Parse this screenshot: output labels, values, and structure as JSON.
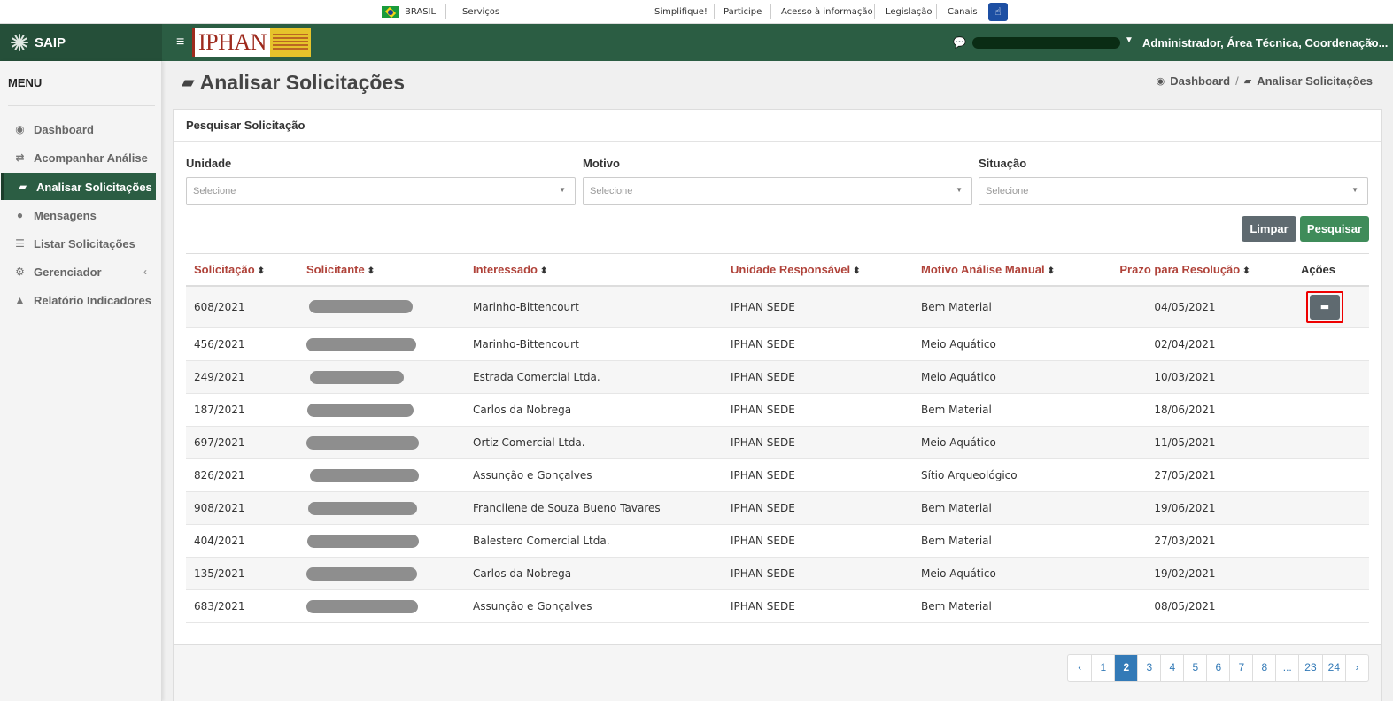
{
  "govbar": {
    "brasil": "BRASIL",
    "servicos": "Serviços",
    "links": [
      "Simplifique!",
      "Participe",
      "Acesso à informação",
      "Legislação",
      "Canais"
    ]
  },
  "header": {
    "app_name": "SAIP",
    "logo_text": "IPHAN",
    "user_roles": "Administrador, Área Técnica, Coordenação..."
  },
  "sidebar": {
    "title": "MENU",
    "items": [
      {
        "label": "Dashboard",
        "icon": "dashboard-icon"
      },
      {
        "label": "Acompanhar Análise",
        "icon": "exchange-icon"
      },
      {
        "label": "Analisar Solicitações",
        "icon": "book-icon",
        "active": true
      },
      {
        "label": "Mensagens",
        "icon": "comments-icon"
      },
      {
        "label": "Listar Solicitações",
        "icon": "list-icon"
      },
      {
        "label": "Gerenciador",
        "icon": "gears-icon"
      },
      {
        "label": "Relatório Indicadores",
        "icon": "area-chart-icon"
      }
    ]
  },
  "page": {
    "title": "Analisar Solicitações",
    "breadcrumb": [
      "Dashboard",
      "Analisar Solicitações"
    ]
  },
  "search": {
    "panel_title": "Pesquisar Solicitação",
    "filters": [
      {
        "label": "Unidade",
        "placeholder": "Selecione"
      },
      {
        "label": "Motivo",
        "placeholder": "Selecione"
      },
      {
        "label": "Situação",
        "placeholder": "Selecione"
      }
    ],
    "clear_label": "Limpar",
    "search_label": "Pesquisar"
  },
  "table": {
    "columns": [
      "Solicitação",
      "Solicitante",
      "Interessado",
      "Unidade Responsável",
      "Motivo Análise Manual",
      "Prazo para Resolução",
      "Ações"
    ],
    "rows": [
      {
        "solicitacao": "608/2021",
        "interessado": "Marinho-Bittencourt",
        "unidade": "IPHAN SEDE",
        "motivo": "Bem Material",
        "prazo": "04/05/2021"
      },
      {
        "solicitacao": "456/2021",
        "interessado": "Marinho-Bittencourt",
        "unidade": "IPHAN SEDE",
        "motivo": "Meio Aquático",
        "prazo": "02/04/2021"
      },
      {
        "solicitacao": "249/2021",
        "interessado": "Estrada Comercial Ltda.",
        "unidade": "IPHAN SEDE",
        "motivo": "Meio Aquático",
        "prazo": "10/03/2021"
      },
      {
        "solicitacao": "187/2021",
        "interessado": "Carlos da Nobrega",
        "unidade": "IPHAN SEDE",
        "motivo": "Bem Material",
        "prazo": "18/06/2021"
      },
      {
        "solicitacao": "697/2021",
        "interessado": "Ortiz Comercial Ltda.",
        "unidade": "IPHAN SEDE",
        "motivo": "Meio Aquático",
        "prazo": "11/05/2021"
      },
      {
        "solicitacao": "826/2021",
        "interessado": "Assunção e Gonçalves",
        "unidade": "IPHAN SEDE",
        "motivo": "Sítio Arqueológico",
        "prazo": "27/05/2021"
      },
      {
        "solicitacao": "908/2021",
        "interessado": "Francilene de Souza Bueno Tavares",
        "unidade": "IPHAN SEDE",
        "motivo": "Bem Material",
        "prazo": "19/06/2021"
      },
      {
        "solicitacao": "404/2021",
        "interessado": "Balestero Comercial Ltda.",
        "unidade": "IPHAN SEDE",
        "motivo": "Bem Material",
        "prazo": "27/03/2021"
      },
      {
        "solicitacao": "135/2021",
        "interessado": "Carlos da Nobrega",
        "unidade": "IPHAN SEDE",
        "motivo": "Meio Aquático",
        "prazo": "19/02/2021"
      },
      {
        "solicitacao": "683/2021",
        "interessado": "Assunção e Gonçalves",
        "unidade": "IPHAN SEDE",
        "motivo": "Bem Material",
        "prazo": "08/05/2021"
      }
    ]
  },
  "pagination": {
    "prev": "‹",
    "next": "›",
    "pages": [
      "1",
      "2",
      "3",
      "4",
      "5",
      "6",
      "7",
      "8",
      "...",
      "23",
      "24"
    ],
    "current": "2"
  },
  "colors": {
    "brand_green": "#2b5d43",
    "header_red": "#b0433a",
    "link_blue": "#337ab7",
    "highlight": "#e00000"
  }
}
